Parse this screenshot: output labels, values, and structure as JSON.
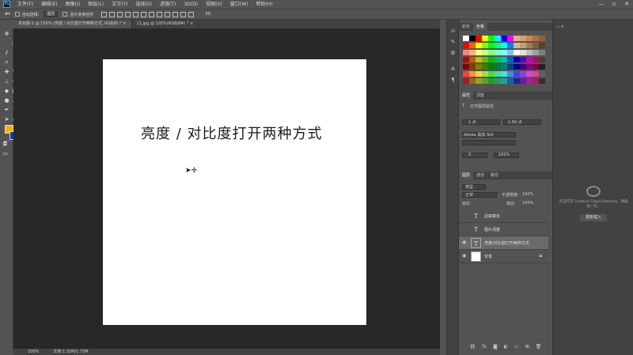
{
  "app": {
    "logo": "Ps"
  },
  "menubar": {
    "items": [
      "文件(F)",
      "编辑(E)",
      "图像(I)",
      "图层(L)",
      "文字(Y)",
      "选择(S)",
      "滤镜(T)",
      "3D(D)",
      "视图(V)",
      "窗口(W)",
      "帮助(H)"
    ]
  },
  "window_controls": {
    "minimize": "—",
    "maximize": "▫",
    "close": "✕"
  },
  "optionsbar": {
    "auto_select_label": "自动选择:",
    "auto_select_value": "图层",
    "transform_label": "显示变换控件"
  },
  "tabs": [
    {
      "label": "未标题-1 @ 100% (亮度 / 对比度打开两种方式, RGB/8) *",
      "close": "×"
    },
    {
      "label": "11.jpg @ 100%(RGB/8#) *",
      "close": "×"
    }
  ],
  "canvas": {
    "text": "亮度 / 对比度打开两种方式",
    "background": "#ffffff"
  },
  "status": {
    "zoom": "100%",
    "doc": "文档:1.32M/1.75M"
  },
  "swatches_panel": {
    "tabs": [
      "颜色",
      "色板"
    ],
    "active": 1
  },
  "char_panel": {
    "tabs": [
      "属性",
      "调整"
    ],
    "title": "文字图层属性",
    "font_size": "1 点",
    "leading": "1.58 点",
    "font_family": "Adobe 黑体 Std",
    "tracking": "0",
    "scale": "100%"
  },
  "layers_panel": {
    "tabs": [
      "图层",
      "通道",
      "路径"
    ],
    "filter": "类型",
    "blend_mode": "正常",
    "opacity_label": "不透明度:",
    "opacity": "100%",
    "lock_label": "锁定:",
    "fill_label": "填充:",
    "fill": "100%",
    "layers": [
      {
        "name": "滤镜菜单",
        "type": "T",
        "visible": false,
        "selected": false
      },
      {
        "name": "图片调整",
        "type": "T",
        "visible": false,
        "selected": false
      },
      {
        "name": "亮度/对比度打开两种方式",
        "type": "T",
        "visible": true,
        "selected": true
      },
      {
        "name": "背景",
        "type": "image",
        "visible": true,
        "selected": false,
        "locked": true
      }
    ]
  },
  "cc_panel": {
    "message": "无法打开 Creative Cloud Libraries。请再试一次。",
    "button": "重新载入"
  },
  "colors": {
    "foreground": "#f0b400",
    "background": "#1438a8"
  }
}
